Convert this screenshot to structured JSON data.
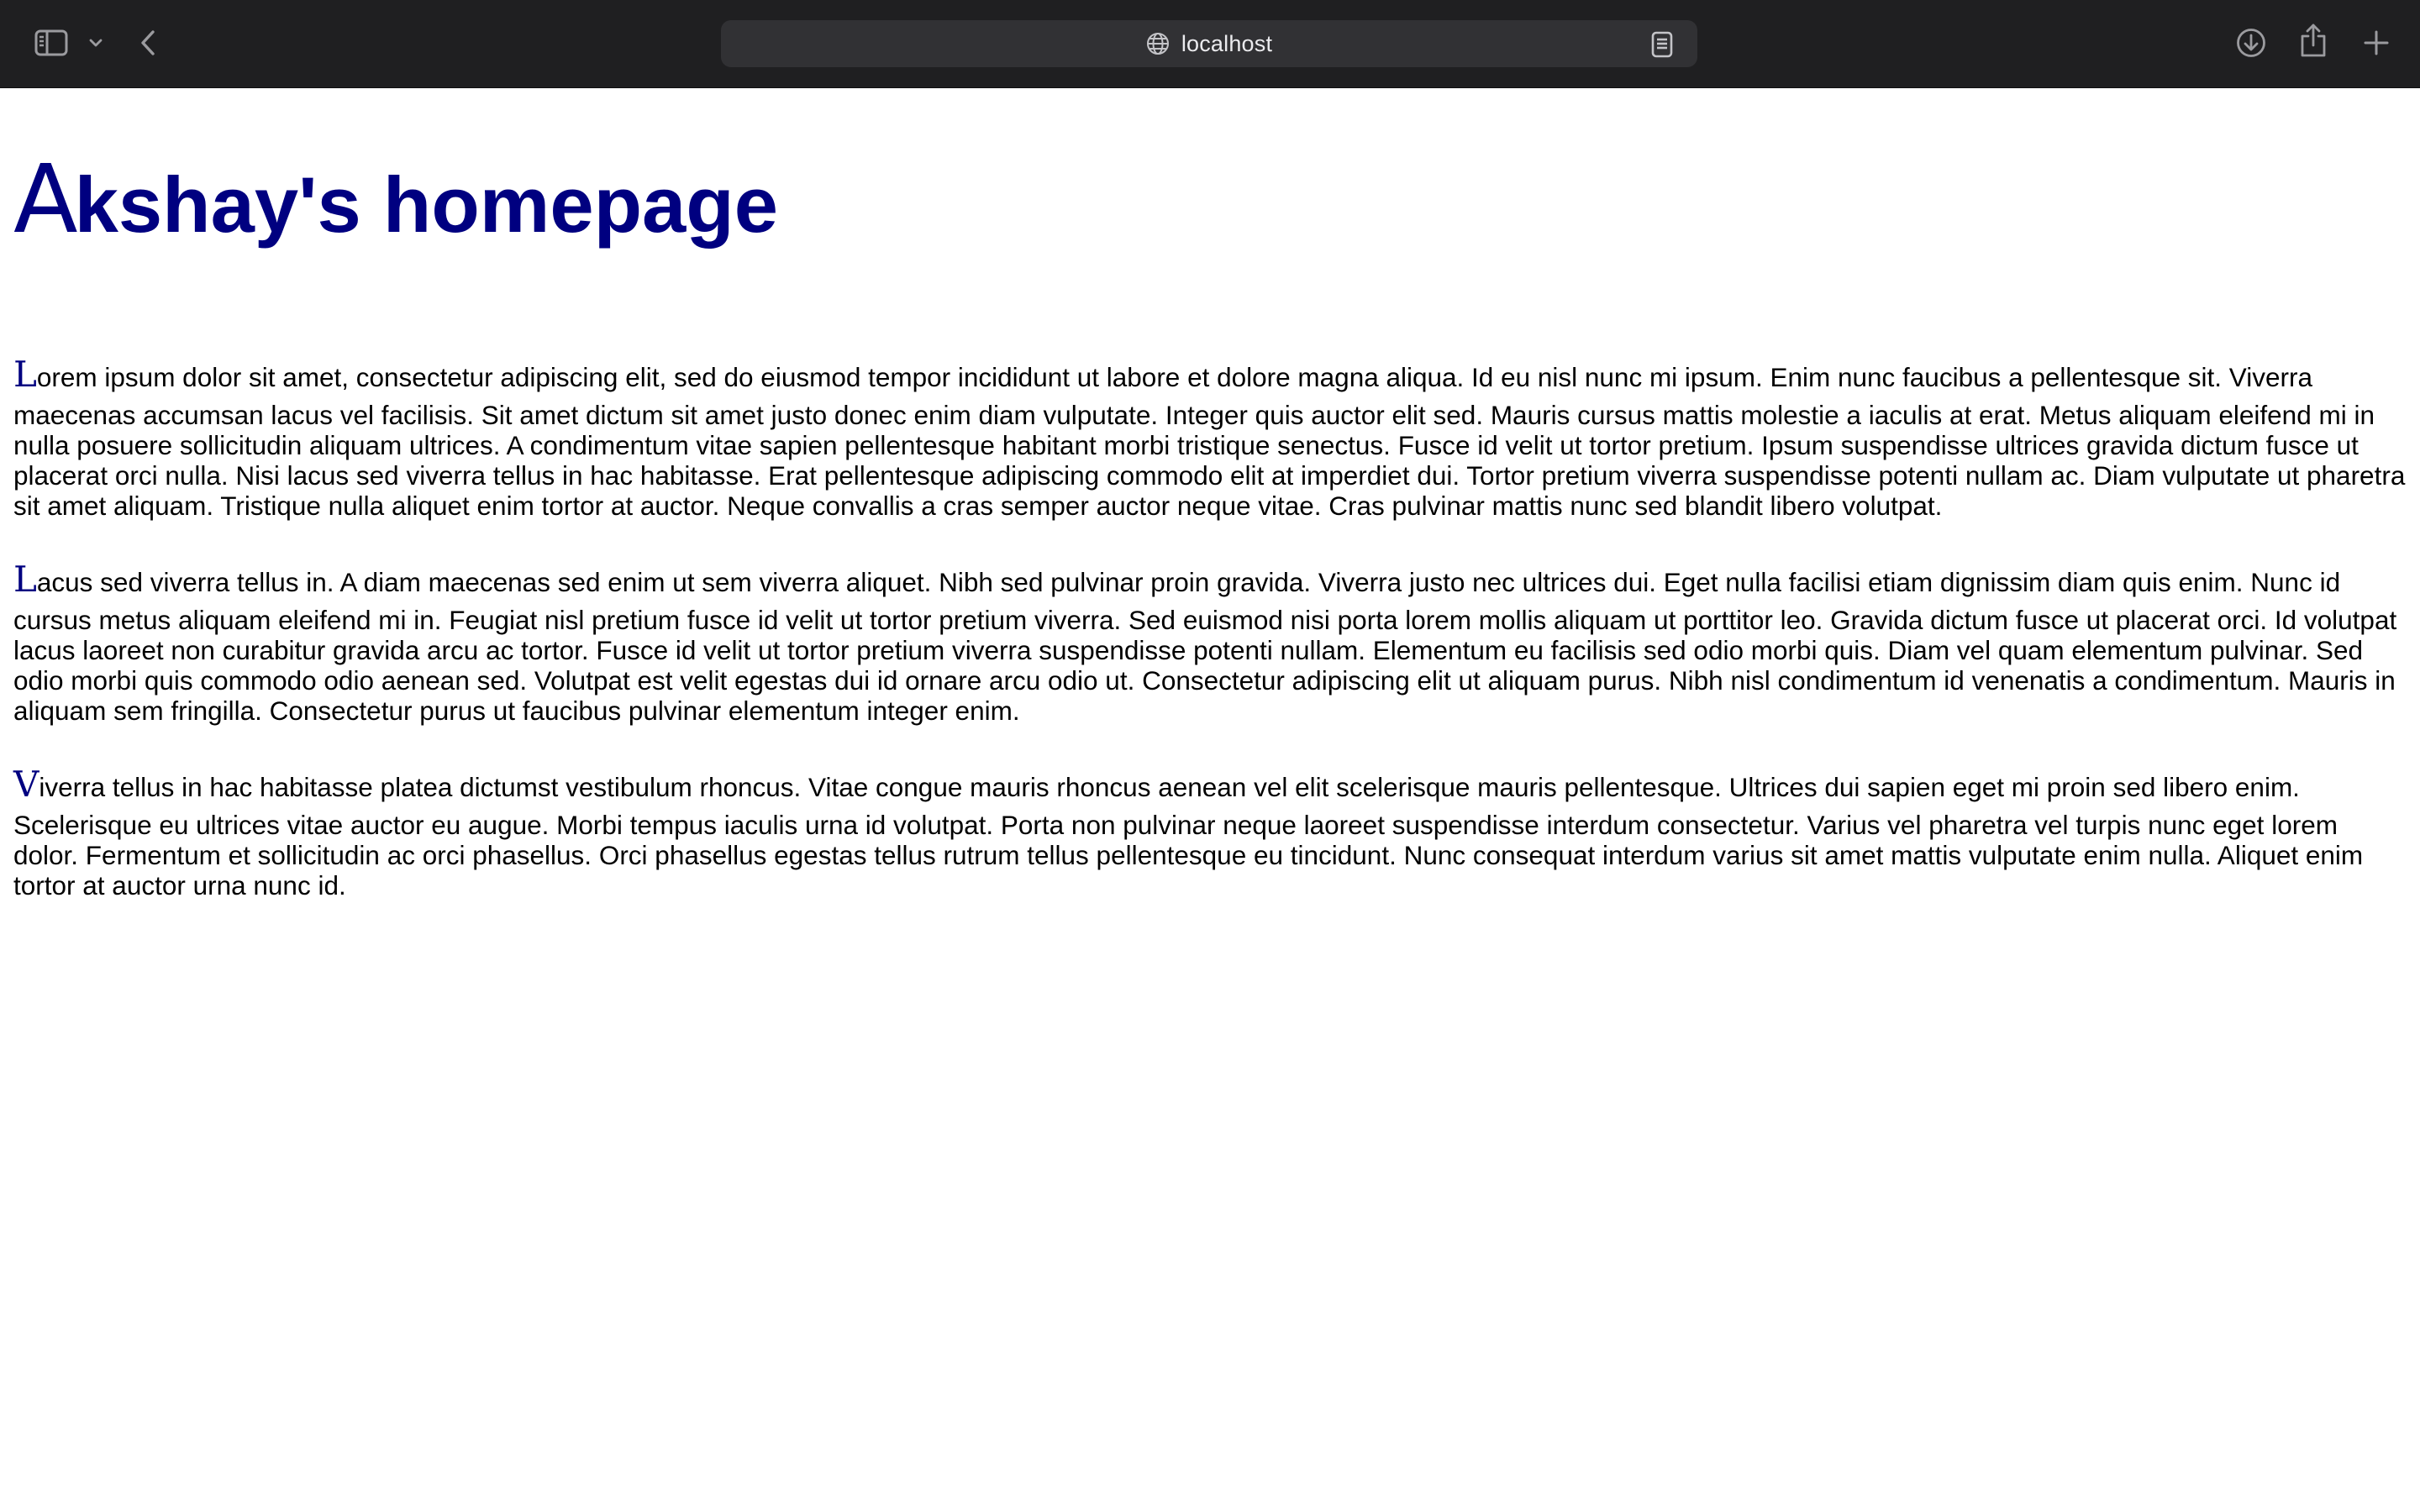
{
  "browser": {
    "url": "localhost",
    "icons": {
      "sidebar": "sidebar-icon",
      "sidebar_menu": "chevron-down-icon",
      "back": "chevron-left-icon",
      "site": "globe-icon",
      "reader": "reader-icon",
      "downloads": "download-icon",
      "share": "share-icon",
      "new_tab": "plus-icon"
    },
    "colors": {
      "toolbar_bg": "#1f1f21",
      "urlbar_bg": "#313134"
    }
  },
  "page": {
    "title_dropcap": "A",
    "title_rest": "kshay's homepage",
    "title_color": "#000080",
    "paragraphs": [
      {
        "dropcap": "L",
        "first_line": "orem ipsum dolor sit amet, consectetur adipiscing elit, sed do eiusmod tempor incididunt ut labore et dolore magna aliqua. Id eu nisl nunc mi ipsum. Enim nunc faucibus a pellentesque sit. Viverra",
        "rest": "maecenas accumsan lacus vel facilisis. Sit amet dictum sit amet justo donec enim diam vulputate. Integer quis auctor elit sed. Mauris cursus mattis molestie a iaculis at erat. Metus aliquam eleifend mi in nulla posuere sollicitudin aliquam ultrices. A condimentum vitae sapien pellentesque habitant morbi tristique senectus. Fusce id velit ut tortor pretium. Ipsum suspendisse ultrices gravida dictum fusce ut placerat orci nulla. Nisi lacus sed viverra tellus in hac habitasse. Erat pellentesque adipiscing commodo elit at imperdiet dui. Tortor pretium viverra suspendisse potenti nullam ac. Diam vulputate ut pharetra sit amet aliquam. Tristique nulla aliquet enim tortor at auctor. Neque convallis a cras semper auctor neque vitae. Cras pulvinar mattis nunc sed blandit libero volutpat."
      },
      {
        "dropcap": "L",
        "first_line": "acus sed viverra tellus in. A diam maecenas sed enim ut sem viverra aliquet. Nibh sed pulvinar proin gravida. Viverra justo nec ultrices dui. Eget nulla facilisi etiam dignissim diam quis enim. Nunc id",
        "rest": "cursus metus aliquam eleifend mi in. Feugiat nisl pretium fusce id velit ut tortor pretium viverra. Sed euismod nisi porta lorem mollis aliquam ut porttitor leo. Gravida dictum fusce ut placerat orci. Id volutpat lacus laoreet non curabitur gravida arcu ac tortor. Fusce id velit ut tortor pretium viverra suspendisse potenti nullam. Elementum eu facilisis sed odio morbi quis. Diam vel quam elementum pulvinar. Sed odio morbi quis commodo odio aenean sed. Volutpat est velit egestas dui id ornare arcu odio ut. Consectetur adipiscing elit ut aliquam purus. Nibh nisl condimentum id venenatis a condimentum. Mauris in aliquam sem fringilla. Consectetur purus ut faucibus pulvinar elementum integer enim."
      },
      {
        "dropcap": "V",
        "first_line": "iverra tellus in hac habitasse platea dictumst vestibulum rhoncus. Vitae congue mauris rhoncus aenean vel elit scelerisque mauris pellentesque. Ultrices dui sapien eget mi proin sed libero enim.",
        "rest": "Scelerisque eu ultrices vitae auctor eu augue. Morbi tempus iaculis urna id volutpat. Porta non pulvinar neque laoreet suspendisse interdum consectetur. Varius vel pharetra vel turpis nunc eget lorem dolor. Fermentum et sollicitudin ac orci phasellus. Orci phasellus egestas tellus rutrum tellus pellentesque eu tincidunt. Nunc consequat interdum varius sit amet mattis vulputate enim nulla. Aliquet enim tortor at auctor urna nunc id."
      }
    ]
  }
}
